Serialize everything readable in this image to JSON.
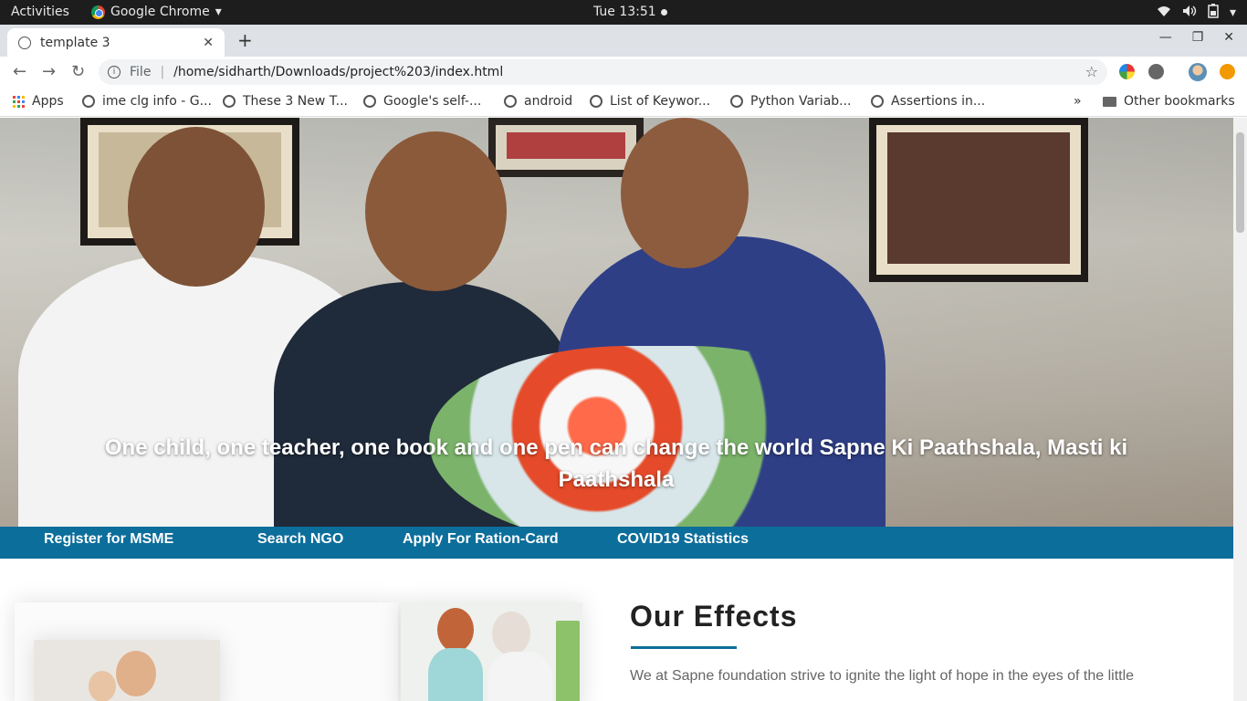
{
  "system": {
    "activities": "Activities",
    "app_name": "Google Chrome",
    "clock": "Tue 13:51"
  },
  "browser": {
    "tab_title": "template 3",
    "address_scheme": "File",
    "address_url": "/home/sidharth/Downloads/project%203/index.html",
    "bookmarks": [
      "Apps",
      "ime clg info - G...",
      "These 3 New T...",
      "Google's self-...",
      "android",
      "List of Keywor...",
      "Python Variab...",
      "Assertions in..."
    ],
    "bookmarks_overflow": "»",
    "other_bookmarks": "Other bookmarks"
  },
  "hero": {
    "caption": "One child, one teacher, one book and one pen can change the world Sapne Ki Paathshala, Masti ki Paathshala"
  },
  "navbar": {
    "items": [
      "Register for MSME",
      "Search NGO",
      "Apply For Ration-Card",
      "COVID19 Statistics"
    ]
  },
  "effects": {
    "title": "Our Effects",
    "text": "We at Sapne foundation strive to ignite the light of hope in the eyes of the little"
  },
  "colors": {
    "navbar": "#0c6e9b",
    "accent_rule": "#0c6e9b"
  }
}
